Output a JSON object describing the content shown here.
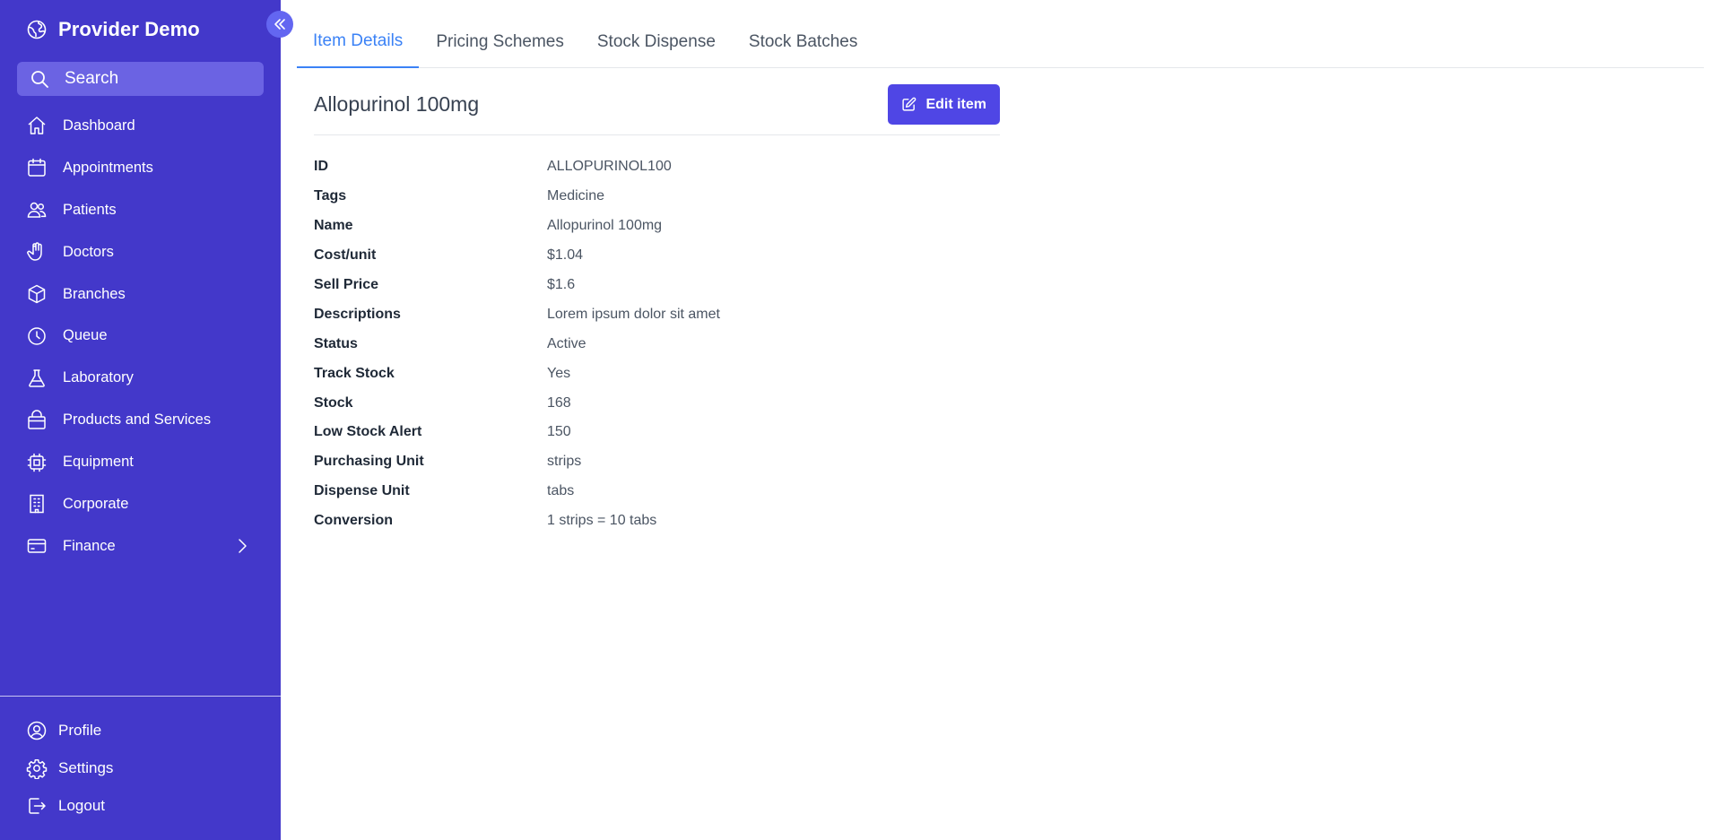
{
  "brand": {
    "name": "Provider Demo"
  },
  "search": {
    "placeholder": "Search"
  },
  "sidebar": {
    "items": [
      {
        "label": "Dashboard",
        "icon": "home-icon"
      },
      {
        "label": "Appointments",
        "icon": "calendar-icon"
      },
      {
        "label": "Patients",
        "icon": "users-icon"
      },
      {
        "label": "Doctors",
        "icon": "hand-icon"
      },
      {
        "label": "Branches",
        "icon": "cube-icon"
      },
      {
        "label": "Queue",
        "icon": "clock-icon"
      },
      {
        "label": "Laboratory",
        "icon": "flask-icon"
      },
      {
        "label": "Products and Services",
        "icon": "shopping-bag-icon"
      },
      {
        "label": "Equipment",
        "icon": "chip-icon"
      },
      {
        "label": "Corporate",
        "icon": "building-icon"
      },
      {
        "label": "Finance",
        "icon": "credit-card-icon"
      }
    ],
    "bottom": [
      {
        "label": "Profile",
        "icon": "user-circle-icon"
      },
      {
        "label": "Settings",
        "icon": "gear-icon"
      },
      {
        "label": "Logout",
        "icon": "logout-icon"
      }
    ]
  },
  "tabs": [
    {
      "label": "Item Details",
      "active": true
    },
    {
      "label": "Pricing Schemes",
      "active": false
    },
    {
      "label": "Stock Dispense",
      "active": false
    },
    {
      "label": "Stock Batches",
      "active": false
    }
  ],
  "item": {
    "title": "Allopurinol 100mg",
    "edit_label": "Edit item",
    "details": [
      {
        "label": "ID",
        "value": "ALLOPURINOL100"
      },
      {
        "label": "Tags",
        "value": "Medicine"
      },
      {
        "label": "Name",
        "value": "Allopurinol 100mg"
      },
      {
        "label": "Cost/unit",
        "value": "$1.04"
      },
      {
        "label": "Sell Price",
        "value": "$1.6"
      },
      {
        "label": "Descriptions",
        "value": "Lorem ipsum dolor sit amet"
      },
      {
        "label": "Status",
        "value": "Active"
      },
      {
        "label": "Track Stock",
        "value": "Yes"
      },
      {
        "label": "Stock",
        "value": "168"
      },
      {
        "label": "Low Stock Alert",
        "value": "150"
      },
      {
        "label": "Purchasing Unit",
        "value": "strips"
      },
      {
        "label": "Dispense Unit",
        "value": "tabs"
      },
      {
        "label": "Conversion",
        "value": "1 strips = 10 tabs"
      }
    ]
  },
  "colors": {
    "sidebar_bg": "#4338ca",
    "accent": "#4f46e5",
    "active_tab": "#3b82f6"
  }
}
